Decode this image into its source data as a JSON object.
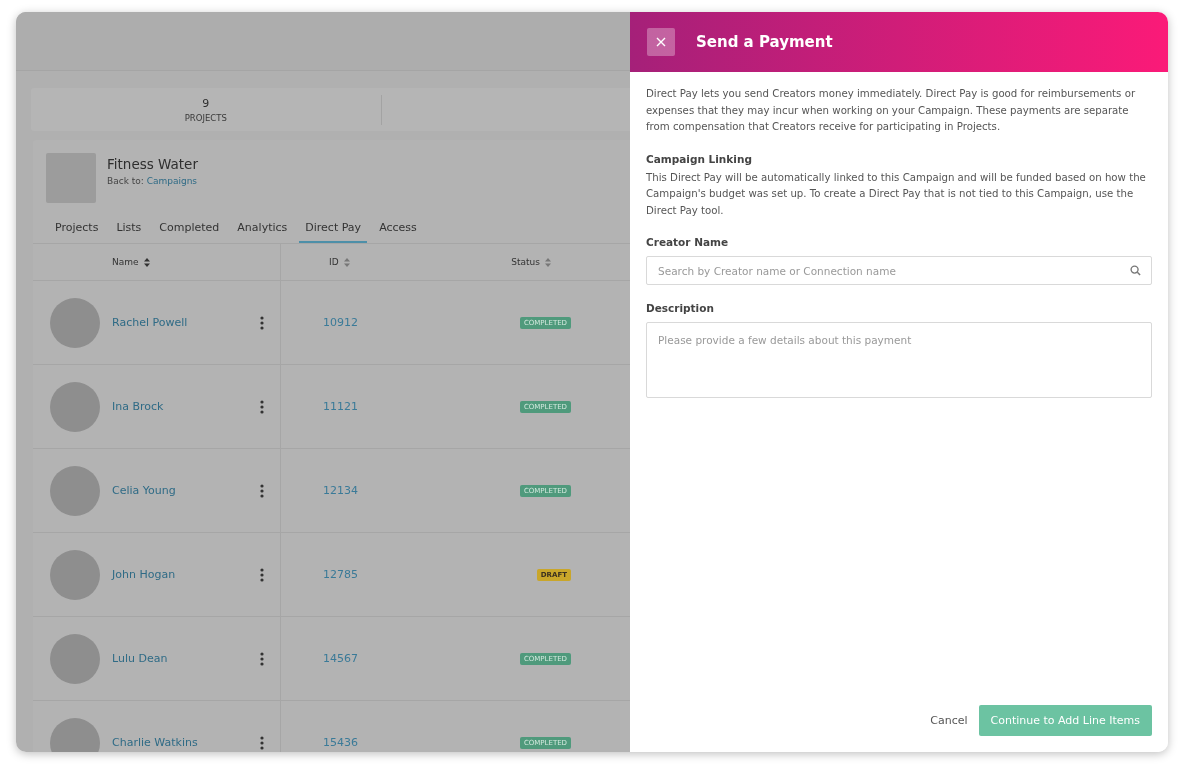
{
  "stats": [
    {
      "value": "9",
      "label": "PROJECTS"
    }
  ],
  "campaign": {
    "title": "Fitness Water",
    "back_label": "Back to:",
    "back_link": "Campaigns"
  },
  "tabs": [
    {
      "label": "Projects",
      "selected": false
    },
    {
      "label": "Lists",
      "selected": false
    },
    {
      "label": "Completed",
      "selected": false
    },
    {
      "label": "Analytics",
      "selected": false
    },
    {
      "label": "Direct Pay",
      "selected": true
    },
    {
      "label": "Access",
      "selected": false
    }
  ],
  "table": {
    "columns": [
      "Name",
      "ID",
      "Status"
    ],
    "rows": [
      {
        "name": "Rachel Powell",
        "id": "10912",
        "status": "COMPLETED",
        "kind": "completed"
      },
      {
        "name": "Ina Brock",
        "id": "11121",
        "status": "COMPLETED",
        "kind": "completed"
      },
      {
        "name": "Celia Young",
        "id": "12134",
        "status": "COMPLETED",
        "kind": "completed"
      },
      {
        "name": "John Hogan",
        "id": "12785",
        "status": "DRAFT",
        "kind": "draft"
      },
      {
        "name": "Lulu Dean",
        "id": "14567",
        "status": "COMPLETED",
        "kind": "completed"
      },
      {
        "name": "Charlie Watkins",
        "id": "15436",
        "status": "COMPLETED",
        "kind": "completed"
      }
    ]
  },
  "panel": {
    "title": "Send a Payment",
    "intro": "Direct Pay lets you send Creators money immediately. Direct Pay is good for reimbursements or expenses that they may incur when working on your Campaign. These payments are separate from compensation that Creators receive for participating in Projects.",
    "section_title": "Campaign Linking",
    "section_text": "This Direct Pay will be automatically linked to this Campaign and will be funded based on how the Campaign's budget was set up. To create a Direct Pay that is not tied to this Campaign, use the Direct Pay tool.",
    "creator_label": "Creator Name",
    "creator_placeholder": "Search by Creator name or Connection name",
    "description_label": "Description",
    "description_placeholder": "Please provide a few details about this payment",
    "cancel": "Cancel",
    "submit": "Continue to Add Line Items"
  }
}
